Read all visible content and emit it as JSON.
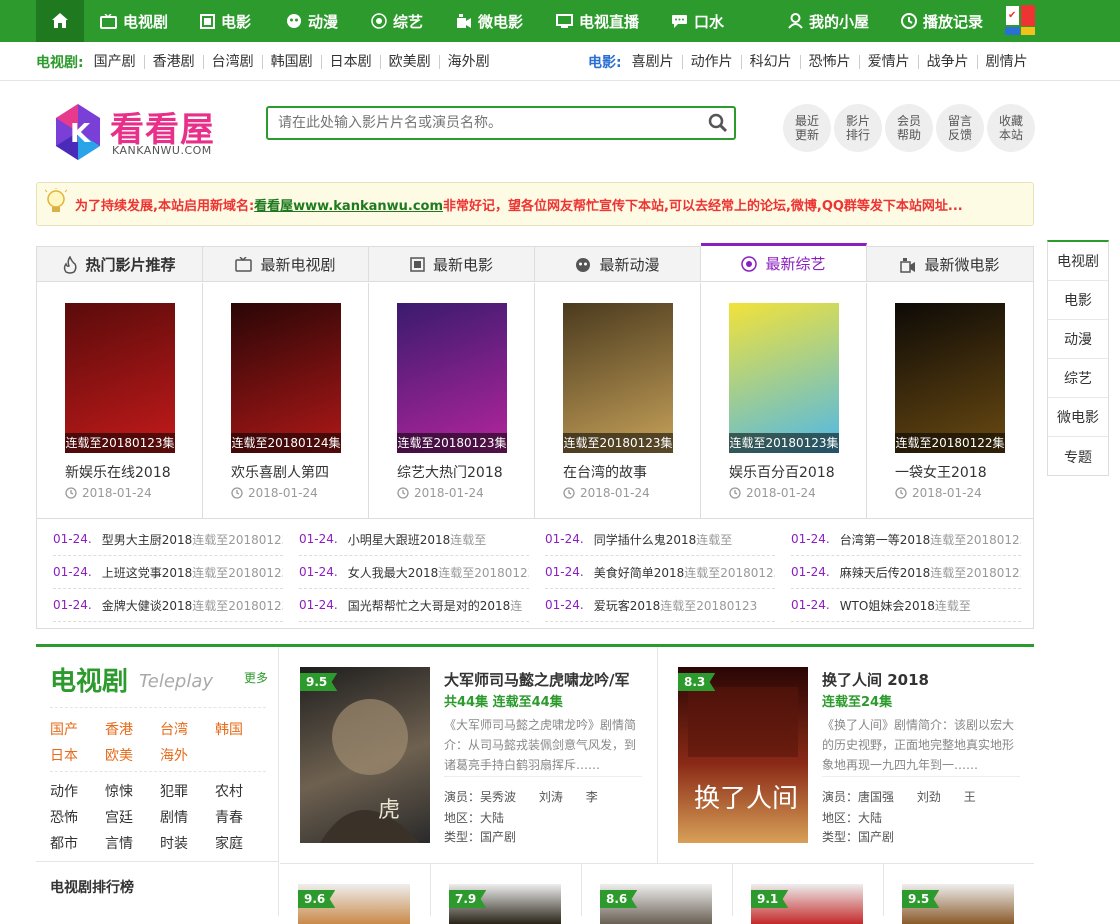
{
  "topnav": {
    "items": [
      {
        "label": "电视剧",
        "icon": "tv-icon"
      },
      {
        "label": "电影",
        "icon": "film-icon"
      },
      {
        "label": "动漫",
        "icon": "anime-icon"
      },
      {
        "label": "综艺",
        "icon": "variety-icon"
      },
      {
        "label": "微电影",
        "icon": "micro-film-icon"
      },
      {
        "label": "电视直播",
        "icon": "monitor-icon"
      },
      {
        "label": "口水",
        "icon": "chat-icon"
      },
      {
        "label": "我的小屋",
        "icon": "user-icon"
      },
      {
        "label": "播放记录",
        "icon": "clock-icon"
      }
    ]
  },
  "subnav": {
    "tv_label": "电视剧:",
    "tv_links": [
      "国产剧",
      "香港剧",
      "台湾剧",
      "韩国剧",
      "日本剧",
      "欧美剧",
      "海外剧"
    ],
    "movie_label": "电影:",
    "movie_links": [
      "喜剧片",
      "动作片",
      "科幻片",
      "恐怖片",
      "爱情片",
      "战争片",
      "剧情片"
    ]
  },
  "logo": {
    "text": "看看屋",
    "domain": "KANKANWU.COM"
  },
  "search": {
    "placeholder": "请在此处输入影片片名或演员名称。"
  },
  "quick_links": [
    {
      "line1": "最近",
      "line2": "更新"
    },
    {
      "line1": "影片",
      "line2": "排行"
    },
    {
      "line1": "会员",
      "line2": "帮助"
    },
    {
      "line1": "留言",
      "line2": "反馈"
    },
    {
      "line1": "收藏",
      "line2": "本站"
    }
  ],
  "notice": {
    "prefix": "为了持续发展,本站启用新域名:",
    "link": "看看屋www.kankanwu.com",
    "suffix": "非常好记，望各位网友帮忙宣传下本站,可以去经常上的论坛,微博,QQ群等发下本站网址..."
  },
  "tabs": [
    {
      "label": "热门影片推荐",
      "icon": "fire-icon"
    },
    {
      "label": "最新电视剧",
      "icon": "tv-icon"
    },
    {
      "label": "最新电影",
      "icon": "film-icon"
    },
    {
      "label": "最新动漫",
      "icon": "anime-icon"
    },
    {
      "label": "最新综艺",
      "icon": "variety-icon"
    },
    {
      "label": "最新微电影",
      "icon": "micro-film-icon"
    }
  ],
  "active_tab": 4,
  "cards": [
    {
      "title": "新娱乐在线2018",
      "status": "连载至20180123集",
      "date": "2018-01-24",
      "bg1": "#5a0b0b",
      "bg2": "#c41a1a"
    },
    {
      "title": "欢乐喜剧人第四",
      "status": "连载至20180124集",
      "date": "2018-01-24",
      "bg1": "#2a0606",
      "bg2": "#b01818"
    },
    {
      "title": "综艺大热门2018",
      "status": "连载至20180123集",
      "date": "2018-01-24",
      "bg1": "#3a1b6e",
      "bg2": "#b4259c"
    },
    {
      "title": "在台湾的故事",
      "status": "连载至20180123集",
      "date": "2018-01-24",
      "bg1": "#4a3a1e",
      "bg2": "#c7a25a"
    },
    {
      "title": "娱乐百分百2018",
      "status": "连载至20180123集",
      "date": "2018-01-24",
      "bg1": "#f2e23a",
      "bg2": "#4fb8e8"
    },
    {
      "title": "一袋女王2018",
      "status": "连载至20180122集",
      "date": "2018-01-24",
      "bg1": "#0d0a06",
      "bg2": "#6a4a12"
    }
  ],
  "updates": [
    {
      "date": "01-24.",
      "name": "型男大主厨2018",
      "status": "连载至20180123"
    },
    {
      "date": "01-24.",
      "name": "小明星大跟班2018",
      "status": "连载至"
    },
    {
      "date": "01-24.",
      "name": "同学插什么鬼2018",
      "status": "连载至"
    },
    {
      "date": "01-24.",
      "name": "台湾第一等2018",
      "status": "连载至20180123"
    },
    {
      "date": "01-24.",
      "name": "上班这党事2018",
      "status": "连载至20180123"
    },
    {
      "date": "01-24.",
      "name": "女人我最大2018",
      "status": "连载至20180123"
    },
    {
      "date": "01-24.",
      "name": "美食好简单2018",
      "status": "连载至20180123"
    },
    {
      "date": "01-24.",
      "name": "麻辣天后传2018",
      "status": "连载至20180123"
    },
    {
      "date": "01-24.",
      "name": "金牌大健谈2018",
      "status": "连载至20180123"
    },
    {
      "date": "01-24.",
      "name": "国光帮帮忙之大哥是对的2018",
      "status": "连"
    },
    {
      "date": "01-24.",
      "name": "爱玩客2018",
      "status": "连载至20180123"
    },
    {
      "date": "01-24.",
      "name": "WTO姐妹会2018",
      "status": "连载至"
    }
  ],
  "right_nav": [
    "电视剧",
    "电影",
    "动漫",
    "综艺",
    "微电影",
    "专题"
  ],
  "tv_section": {
    "title": "电视剧",
    "subtitle": "Teleplay",
    "more": "更多",
    "regions": [
      "国产",
      "香港",
      "台湾",
      "韩国",
      "日本",
      "欧美",
      "海外"
    ],
    "genres": [
      "动作",
      "惊悚",
      "犯罪",
      "农村",
      "恐怖",
      "宫廷",
      "剧情",
      "青春",
      "都市",
      "言情",
      "时装",
      "家庭"
    ],
    "ranking_title": "电视剧排行榜"
  },
  "featured": [
    {
      "score": "9.5",
      "title": "大军师司马懿之虎啸龙吟/军",
      "status": "共44集 连载至44集",
      "desc": "《大军师司马懿之虎啸龙吟》剧情简介：从司马懿戎装佩剑意气风发，到诸葛亮手持白鹤羽扇挥斥……",
      "actors_label": "演员：",
      "actors": "吴秀波      刘涛      李",
      "area_label": "地区：",
      "area": "大陆",
      "type_label": "类型：",
      "type": "国产剧",
      "bg1": "#2a2a2a",
      "bg2": "#8c7a62"
    },
    {
      "score": "8.3",
      "title": "换了人间 2018",
      "status": "连载至24集",
      "desc": "《换了人间》剧情简介：该剧以宏大的历史视野，正面地完整地真实地形象地再现一九四九年到一……",
      "actors_label": "演员：",
      "actors": "唐国强      刘劲      王",
      "area_label": "地区：",
      "area": "大陆",
      "type_label": "类型：",
      "type": "国产剧",
      "bg1": "#3a0a08",
      "bg2": "#b83a20"
    }
  ],
  "small_cards": [
    {
      "score": "9.6",
      "bg": "#c98a4a"
    },
    {
      "score": "7.9",
      "bg": "#2a2418"
    },
    {
      "score": "8.6",
      "bg": "#6a6054"
    },
    {
      "score": "9.1",
      "bg": "#c42a2a"
    },
    {
      "score": "9.5",
      "bg": "#8a5a2a"
    }
  ]
}
